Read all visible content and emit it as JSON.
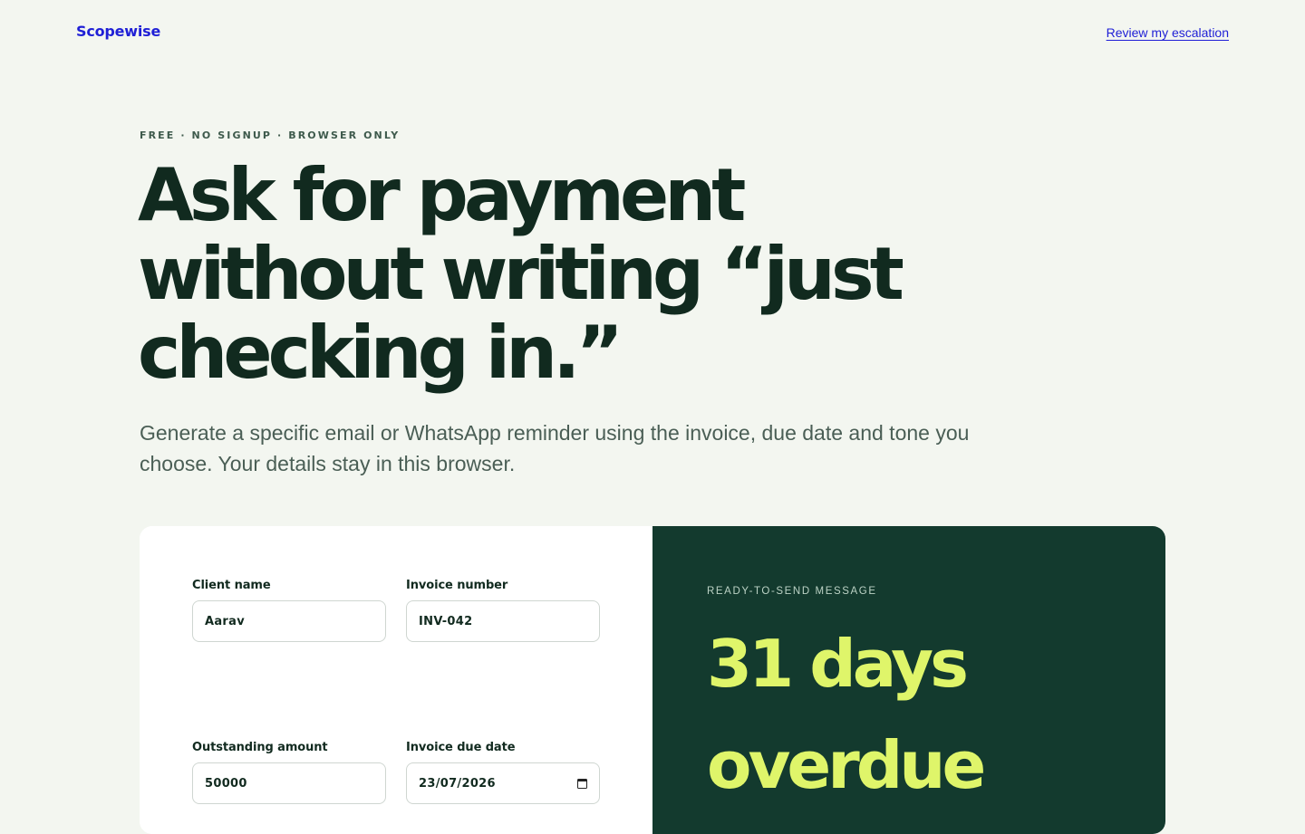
{
  "header": {
    "brand": "Scopewise",
    "review_link": "Review my escalation"
  },
  "hero": {
    "eyebrow": "FREE · NO SIGNUP · BROWSER ONLY",
    "headline": "Ask for payment without writing “just checking in.”",
    "subhead": "Generate a specific email or WhatsApp reminder using the invoice, due date and tone you choose. Your details stay in this browser."
  },
  "form": {
    "client_name": {
      "label": "Client name",
      "value": "Aarav"
    },
    "invoice_number": {
      "label": "Invoice number",
      "value": "INV-042"
    },
    "outstanding_amount": {
      "label": "Outstanding amount",
      "value": "50000"
    },
    "invoice_due_date": {
      "label": "Invoice due date",
      "value": "23/07/2026",
      "icon": "calendar-icon"
    }
  },
  "output": {
    "label": "READY-TO-SEND MESSAGE",
    "headline": "31 days overdue"
  },
  "colors": {
    "background": "#f3f6f0",
    "brand": "#1f1fd6",
    "ink": "#112a1f",
    "panel_dark": "#133a2e",
    "accent_lime": "#dff56a"
  }
}
